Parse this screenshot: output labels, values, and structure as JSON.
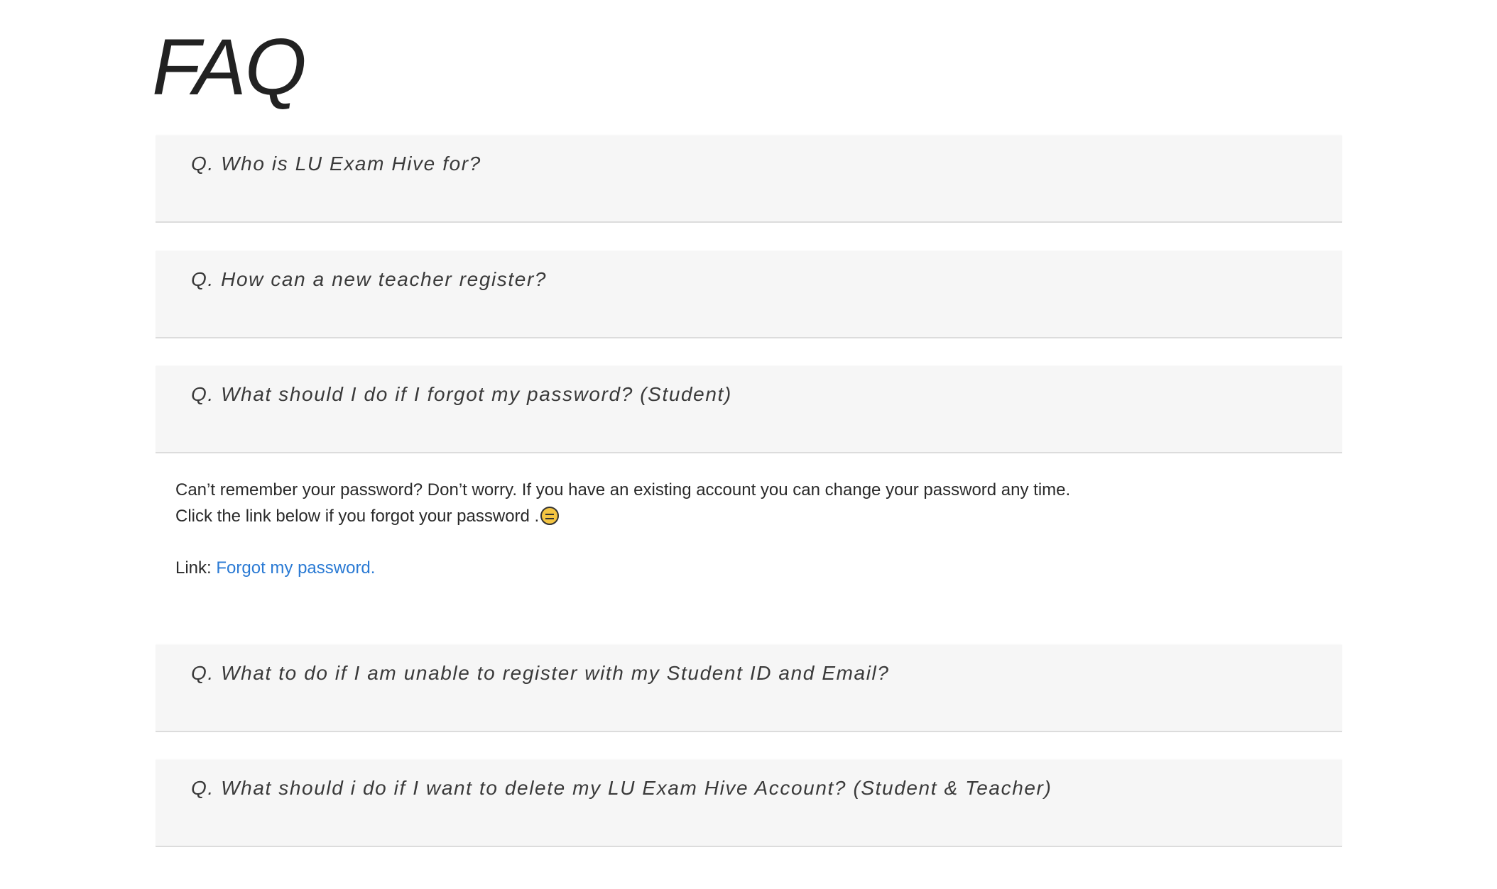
{
  "page_title": "FAQ",
  "faqs": [
    {
      "question": "Q. Who is LU Exam Hive for?"
    },
    {
      "question": "Q. How can a new teacher register?"
    },
    {
      "question": "Q. What should I do if I forgot my password? (Student)",
      "answer": {
        "line1": "Can’t remember your password? Don’t worry. If you have an existing account you can change your password any time.",
        "line2": "Click the link below if you forgot your password .",
        "link_prefix": "Link: ",
        "link_text": "Forgot my password."
      }
    },
    {
      "question": "Q. What to do if I am unable to register with my Student ID and Email?"
    },
    {
      "question": "Q. What should i do if I want to delete my LU Exam Hive Account? (Student & Teacher)"
    }
  ],
  "colors": {
    "link": "#2a7ad4",
    "panel_bg": "#f6f6f6"
  },
  "icons": {
    "answer_emoji": "expressionless-face-icon"
  }
}
